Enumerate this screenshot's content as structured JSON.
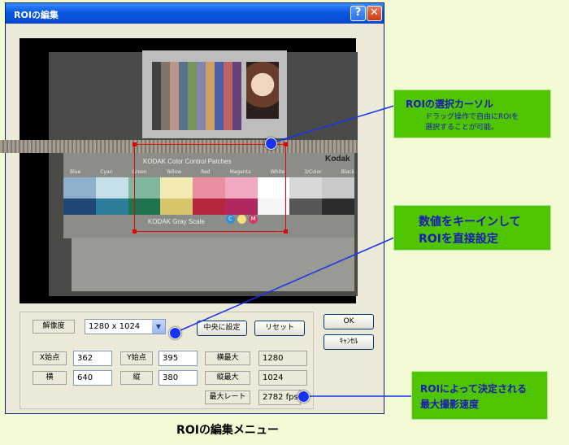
{
  "window": {
    "title": "ROIの編集",
    "help_symbol": "?",
    "close_symbol": "✕"
  },
  "preview": {
    "chart_title": "KODAK Color Control Patches",
    "gray_scale_label": "KODAK Gray Scale",
    "brand": "Kodak",
    "patch_labels": [
      "Blue",
      "Cyan",
      "Green",
      "Yellow",
      "Red",
      "Magenta",
      "White",
      "3/Color",
      "Black"
    ],
    "chips": [
      "C",
      "M"
    ]
  },
  "controls": {
    "resolution_label": "解像度",
    "resolution_value": "1280 x 1024",
    "center_button": "中央に設定",
    "reset_button": "リセット",
    "x_start_label": "X始点",
    "x_start_value": "362",
    "y_start_label": "Y始点",
    "y_start_value": "395",
    "width_max_label": "横最大",
    "width_max_value": "1280",
    "width_label": "横",
    "width_value": "640",
    "height_label": "縦",
    "height_value": "380",
    "height_max_label": "縦最大",
    "height_max_value": "1024",
    "max_rate_label": "最大レート",
    "max_rate_value": "2782 fps",
    "ok_button": "OK",
    "cancel_button": "ｷｬﾝｾﾙ"
  },
  "callouts": {
    "roi_cursor_title": "ROIの選択カーソル",
    "roi_cursor_line1": "ドラッグ操作で自由にROIを",
    "roi_cursor_line2": "選択することが可能。",
    "direct_line1": "数値をキーインして",
    "direct_line2": "ROIを直接設定",
    "rate_line1": "ROIによって決定される",
    "rate_line2": "最大撮影速度"
  },
  "caption": "ROIの編集メニュー",
  "colors": {
    "callout_bg": "#4fc400",
    "callout_text": "#1a1ab8",
    "roi_rect": "#e30000",
    "page_bg": "#f3fbd5",
    "titlebar": "#0a58e0"
  },
  "icons": [
    "help-icon",
    "close-icon",
    "dropdown-arrow-icon"
  ]
}
